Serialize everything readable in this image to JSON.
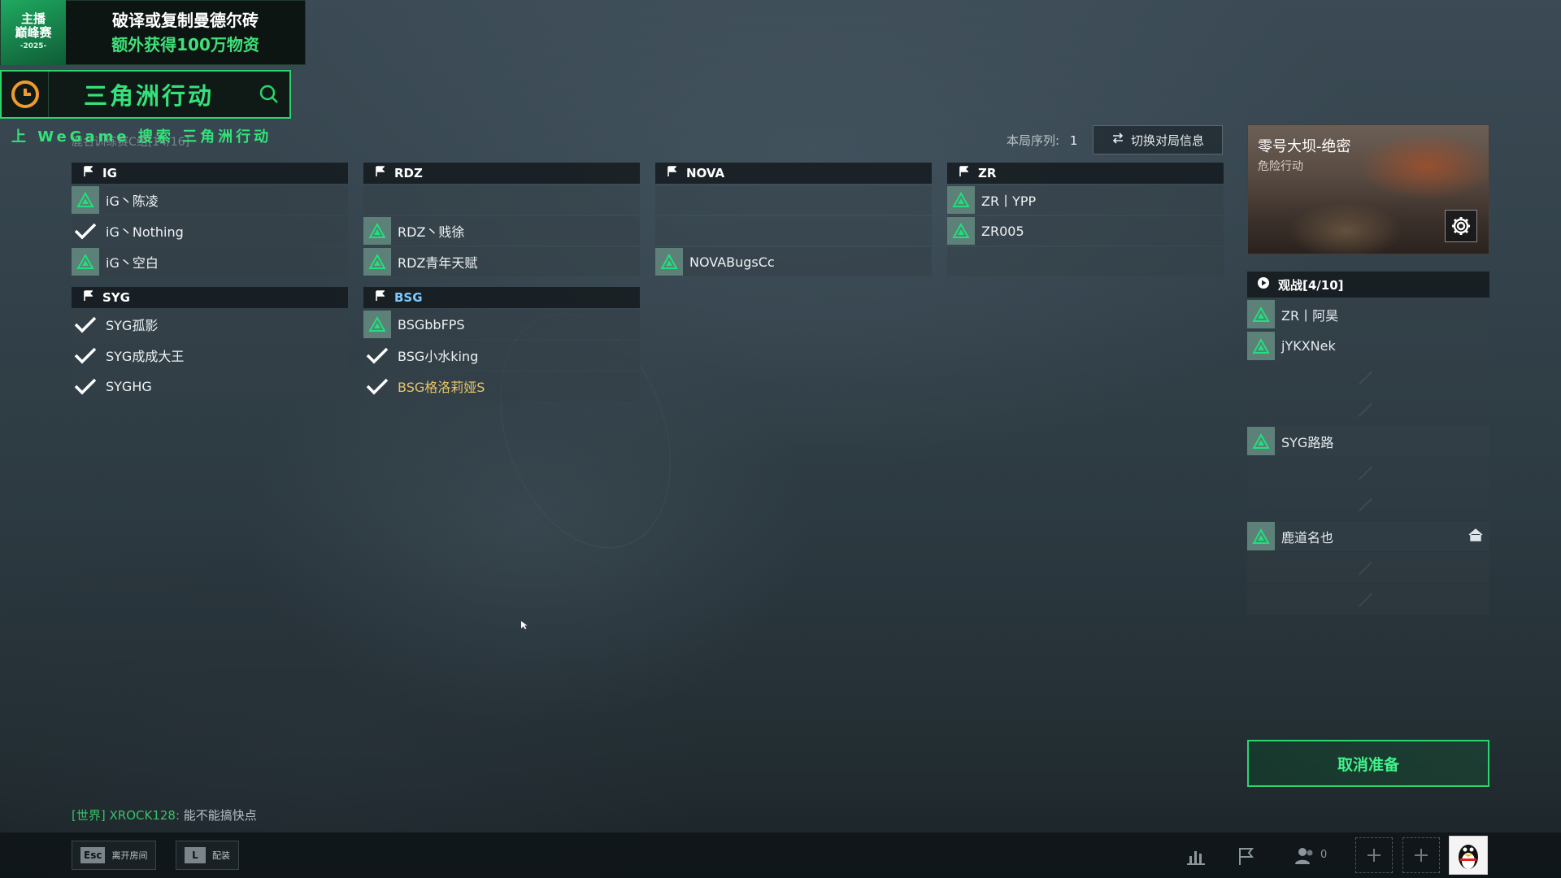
{
  "promo": {
    "logo_line1": "主播",
    "logo_line2": "巅峰赛",
    "logo_year": "-2025-",
    "line1": "破译或复制曼德尔砖",
    "line2": "额外获得100万物资"
  },
  "searchbar": {
    "keyword": "三角洲行动",
    "caption": "上 WeGame 搜索 三角洲行动"
  },
  "room": {
    "name": "鹿名训练赛C组[14/16]",
    "order_label": "本局序列:",
    "order_value": "1",
    "switch_label": "切换对局信息"
  },
  "teams": [
    {
      "name": "IG",
      "slots": [
        {
          "status": "pending",
          "player": "iG丶陈凌"
        },
        {
          "status": "ready",
          "player": "iG丶Nothing"
        },
        {
          "status": "pending",
          "player": "iG丶空白"
        }
      ]
    },
    {
      "name": "RDZ",
      "slots": [
        {
          "status": "empty",
          "player": ""
        },
        {
          "status": "pending",
          "player": "RDZ丶贱徐"
        },
        {
          "status": "pending",
          "player": "RDZ青年天赋"
        }
      ]
    },
    {
      "name": "NOVA",
      "slots": [
        {
          "status": "empty",
          "player": ""
        },
        {
          "status": "empty",
          "player": ""
        },
        {
          "status": "pending",
          "player": "NOVABugsCc"
        }
      ]
    },
    {
      "name": "ZR",
      "slots": [
        {
          "status": "pending",
          "player": "ZR丨YPP"
        },
        {
          "status": "pending",
          "player": "ZR005"
        },
        {
          "status": "empty",
          "player": ""
        }
      ]
    },
    {
      "name": "SYG",
      "slots": [
        {
          "status": "ready",
          "player": "SYG孤影"
        },
        {
          "status": "ready",
          "player": "SYG成成大王"
        },
        {
          "status": "ready",
          "player": "SYGHG"
        }
      ]
    },
    {
      "name": "BSG",
      "highlight": true,
      "slots": [
        {
          "status": "pending",
          "player": "BSGbbFPS"
        },
        {
          "status": "ready",
          "player": "BSG小水king"
        },
        {
          "status": "ready",
          "player": "BSG格洛莉娅S",
          "self": true
        }
      ]
    }
  ],
  "map": {
    "title": "零号大坝-绝密",
    "subtitle": "危险行动",
    "settings_icon": "gear-icon"
  },
  "spectate": {
    "label": "观战[4/10]",
    "slots": [
      {
        "player": "ZR丨阿昊"
      },
      {
        "player": "jYKXNek"
      },
      {
        "player": ""
      },
      {
        "player": ""
      },
      {
        "player": "SYG路路"
      },
      {
        "player": ""
      },
      {
        "player": ""
      },
      {
        "player": "鹿道名也",
        "host": true
      },
      {
        "player": ""
      },
      {
        "player": ""
      }
    ]
  },
  "cancel_ready": "取消准备",
  "chat": {
    "channel": "[世界]",
    "sender": "XROCK128:",
    "message": "能不能搞快点"
  },
  "bottom": {
    "esc_key": "Esc",
    "esc_label": "离开房间",
    "l_key": "L",
    "l_label": "配装",
    "friends_count": "0"
  },
  "colors": {
    "accent_green": "#2dd571",
    "ready_check": "#ffffff",
    "pending_triangle_bg": "#5d8078",
    "self_name": "#e5c56a",
    "highlight_team": "#7ec9ff"
  }
}
